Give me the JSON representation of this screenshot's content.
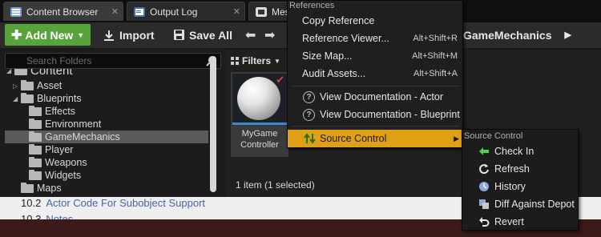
{
  "tabs": [
    {
      "label": "Content Browser"
    },
    {
      "label": "Output Log"
    },
    {
      "label": "Mes"
    }
  ],
  "toolbar": {
    "add_new": "Add New",
    "import": "Import",
    "save_all": "Save All",
    "path": "GameMechanics"
  },
  "folder_panel": {
    "search_placeholder": "Search Folders",
    "root": "Content",
    "items": [
      "Asset",
      "Blueprints",
      "Effects",
      "Environment",
      "GameMechanics",
      "Player",
      "Weapons",
      "Widgets",
      "Maps"
    ],
    "selected": "GameMechanics"
  },
  "asset_panel": {
    "filters_label": "Filters",
    "asset_name": "MyGame Controller",
    "items_count": "1 item (1 selected)"
  },
  "context_menu": {
    "references_header": "References",
    "items": [
      {
        "label": "Copy Reference",
        "shortcut": ""
      },
      {
        "label": "Reference Viewer...",
        "shortcut": "Alt+Shift+R"
      },
      {
        "label": "Size Map...",
        "shortcut": "Alt+Shift+M"
      },
      {
        "label": "Audit Assets...",
        "shortcut": "Alt+Shift+A"
      }
    ],
    "doc_items": [
      "View Documentation - Actor",
      "View Documentation - Blueprint"
    ],
    "source_control": "Source Control"
  },
  "submenu": {
    "header": "Source Control",
    "items": [
      "Check In",
      "Refresh",
      "History",
      "Diff Against Depot",
      "Revert"
    ]
  },
  "background_page": {
    "line1_num": "10.2",
    "line1_text": "Actor Code For Subobject Support",
    "line2_num": "10.3",
    "line2_text": "Notes"
  },
  "colors": {
    "add_new_green": "#59a33c",
    "highlight_orange": "#e0a015",
    "selection_blue": "#3f86d0"
  }
}
